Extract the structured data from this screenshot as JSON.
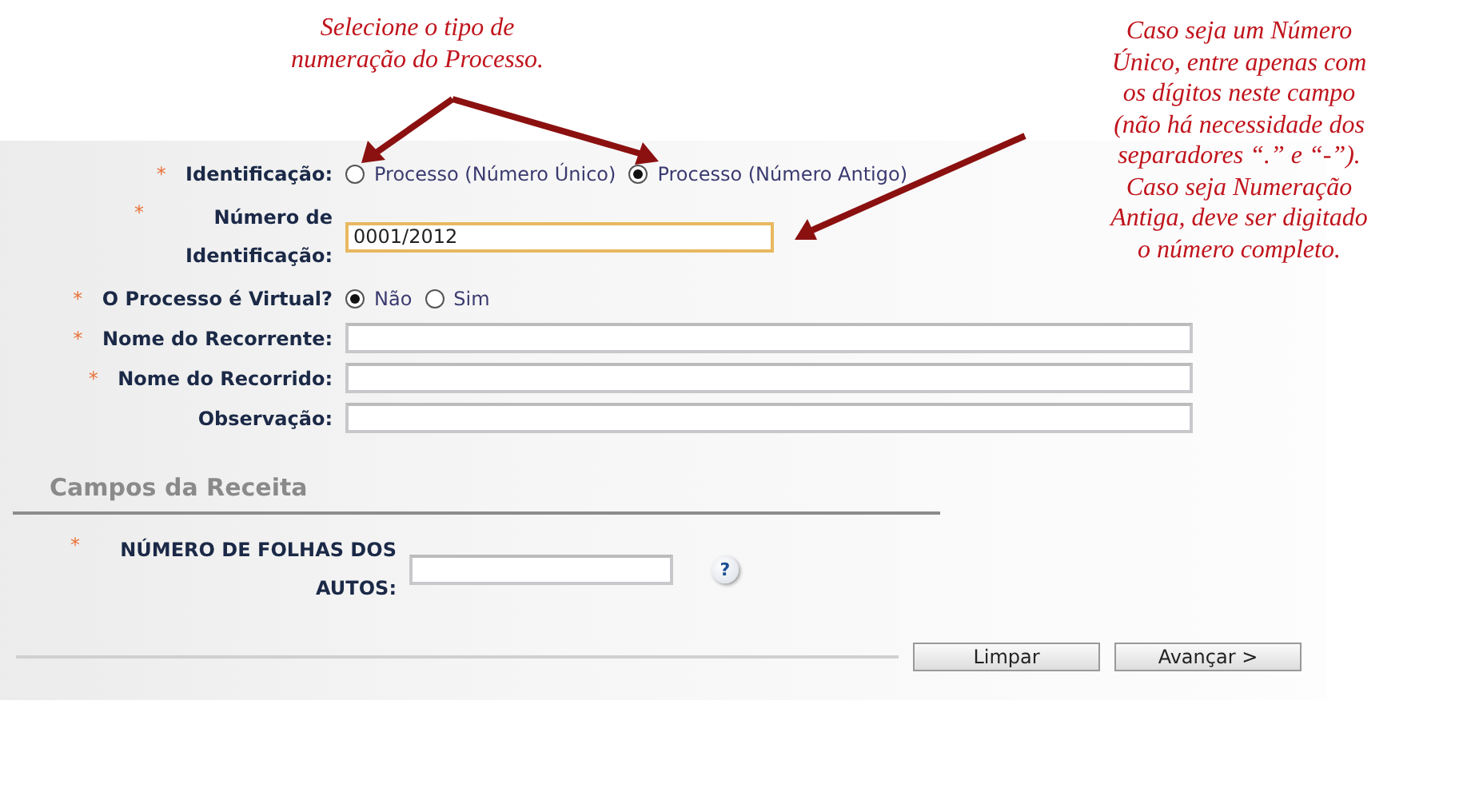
{
  "annotations": [
    {
      "lines": [
        "Selecione o tipo de",
        "numeração do Processo."
      ]
    },
    {
      "lines": [
        "Caso seja um Número",
        "Único, entre apenas com",
        "os dígitos neste campo",
        "(não há necessidade dos",
        "separadores “.” e “-”).",
        "Caso seja Numeração",
        "Antiga, deve ser digitado",
        "o número completo."
      ]
    }
  ],
  "form": {
    "fields": [
      {
        "kind": "radio",
        "label": "Identificação:",
        "required": "*",
        "options": [
          {
            "label": "Processo (Número Único)",
            "selected": false
          },
          {
            "label": "Processo (Número Antigo)",
            "selected": true
          }
        ]
      },
      {
        "kind": "text",
        "label": "Número de Identificação:",
        "required": "*",
        "value": "0001/2012",
        "focused": true
      },
      {
        "kind": "radio",
        "label": "O Processo é Virtual?",
        "required": "*",
        "options": [
          {
            "label": "Não",
            "selected": true
          },
          {
            "label": "Sim",
            "selected": false
          }
        ]
      },
      {
        "kind": "text",
        "label": "Nome do Recorrente:",
        "required": "*",
        "focused": false
      },
      {
        "kind": "text",
        "label": "Nome do Recorrido:",
        "required": "*",
        "focused": false
      },
      {
        "kind": "text",
        "label": "Observação:",
        "focused": false
      }
    ]
  },
  "section": {
    "title": "Campos da Receita",
    "fields": [
      {
        "kind": "text",
        "label": "NÚMERO DE FOLHAS DOS AUTOS:",
        "required": "*",
        "focused": false,
        "help": "?"
      }
    ]
  },
  "buttons": [
    {
      "label": "Limpar"
    },
    {
      "label": "Avançar >"
    }
  ]
}
